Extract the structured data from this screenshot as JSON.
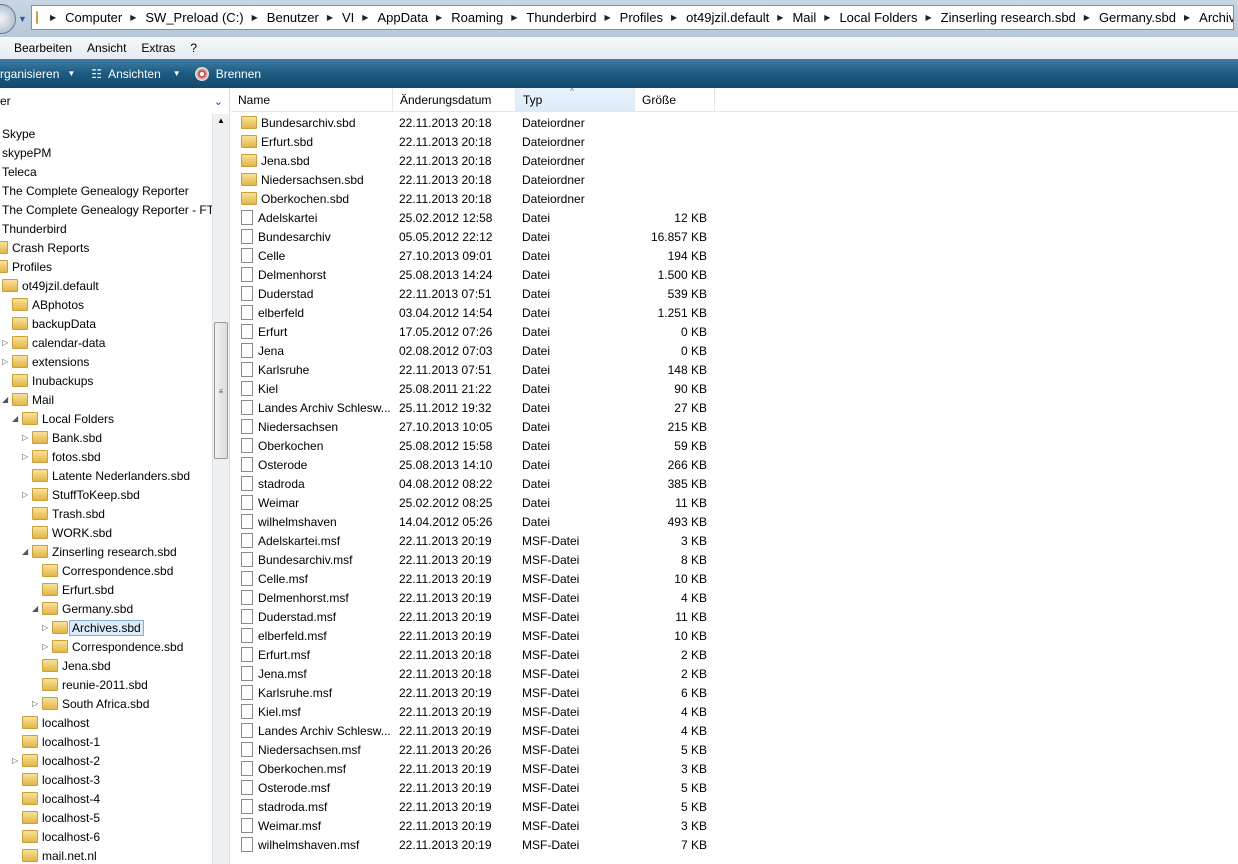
{
  "address": {
    "crumbs": [
      "Computer",
      "SW_Preload (C:)",
      "Benutzer",
      "VI",
      "AppData",
      "Roaming",
      "Thunderbird",
      "Profiles",
      "ot49jzil.default",
      "Mail",
      "Local Folders",
      "Zinserling research.sbd",
      "Germany.sbd",
      "Archives.sbd"
    ]
  },
  "menu": [
    "Bearbeiten",
    "Ansicht",
    "Extras",
    "?"
  ],
  "toolbar": {
    "organize": "rganisieren",
    "views": "Ansichten",
    "burn": "Brennen"
  },
  "tree": {
    "header": "er",
    "items": [
      {
        "label": "Skype",
        "x": 0,
        "a": ""
      },
      {
        "label": "skypePM",
        "x": 0,
        "a": ""
      },
      {
        "label": "Teleca",
        "x": 0,
        "a": ""
      },
      {
        "label": "The Complete Genealogy Reporter",
        "x": 0,
        "a": ""
      },
      {
        "label": "The Complete Genealogy Reporter - FTE",
        "x": 0,
        "a": ""
      },
      {
        "label": "Thunderbird",
        "x": 0,
        "a": ""
      },
      {
        "label": "Crash Reports",
        "x": 1,
        "a": ""
      },
      {
        "label": "Profiles",
        "x": 1,
        "a": ""
      },
      {
        "label": "ot49jzil.default",
        "x": 2,
        "a": "open"
      },
      {
        "label": "ABphotos",
        "x": 3,
        "a": ""
      },
      {
        "label": "backupData",
        "x": 3,
        "a": ""
      },
      {
        "label": "calendar-data",
        "x": 3,
        "a": "closed"
      },
      {
        "label": "extensions",
        "x": 3,
        "a": "closed"
      },
      {
        "label": "Inubackups",
        "x": 3,
        "a": ""
      },
      {
        "label": "Mail",
        "x": 3,
        "a": "open"
      },
      {
        "label": "Local Folders",
        "x": 4,
        "a": "open"
      },
      {
        "label": "Bank.sbd",
        "x": 5,
        "a": "closed"
      },
      {
        "label": "fotos.sbd",
        "x": 5,
        "a": "closed"
      },
      {
        "label": "Latente Nederlanders.sbd",
        "x": 5,
        "a": ""
      },
      {
        "label": "StuffToKeep.sbd",
        "x": 5,
        "a": "closed"
      },
      {
        "label": "Trash.sbd",
        "x": 5,
        "a": ""
      },
      {
        "label": "WORK.sbd",
        "x": 5,
        "a": ""
      },
      {
        "label": "Zinserling research.sbd",
        "x": 5,
        "a": "open"
      },
      {
        "label": "Correspondence.sbd",
        "x": 6,
        "a": ""
      },
      {
        "label": "Erfurt.sbd",
        "x": 6,
        "a": ""
      },
      {
        "label": "Germany.sbd",
        "x": 6,
        "a": "open"
      },
      {
        "label": "Archives.sbd",
        "x": 7,
        "a": "closed",
        "selected": true
      },
      {
        "label": "Correspondence.sbd",
        "x": 7,
        "a": "closed"
      },
      {
        "label": "Jena.sbd",
        "x": 6,
        "a": ""
      },
      {
        "label": "reunie-2011.sbd",
        "x": 6,
        "a": ""
      },
      {
        "label": "South Africa.sbd",
        "x": 6,
        "a": "closed"
      },
      {
        "label": "localhost",
        "x": 4,
        "a": ""
      },
      {
        "label": "localhost-1",
        "x": 4,
        "a": ""
      },
      {
        "label": "localhost-2",
        "x": 4,
        "a": "closed"
      },
      {
        "label": "localhost-3",
        "x": 4,
        "a": ""
      },
      {
        "label": "localhost-4",
        "x": 4,
        "a": ""
      },
      {
        "label": "localhost-5",
        "x": 4,
        "a": ""
      },
      {
        "label": "localhost-6",
        "x": 4,
        "a": ""
      },
      {
        "label": "mail.net.nl",
        "x": 4,
        "a": ""
      }
    ]
  },
  "columns": [
    "Name",
    "Änderungsdatum",
    "Typ",
    "Größe"
  ],
  "files": [
    [
      "Bundesarchiv.sbd",
      "22.11.2013 20:18",
      "Dateiordner",
      ""
    ],
    [
      "Erfurt.sbd",
      "22.11.2013 20:18",
      "Dateiordner",
      ""
    ],
    [
      "Jena.sbd",
      "22.11.2013 20:18",
      "Dateiordner",
      ""
    ],
    [
      "Niedersachsen.sbd",
      "22.11.2013 20:18",
      "Dateiordner",
      ""
    ],
    [
      "Oberkochen.sbd",
      "22.11.2013 20:18",
      "Dateiordner",
      ""
    ],
    [
      "Adelskartei",
      "25.02.2012 12:58",
      "Datei",
      "12 KB"
    ],
    [
      "Bundesarchiv",
      "05.05.2012 22:12",
      "Datei",
      "16.857 KB"
    ],
    [
      "Celle",
      "27.10.2013 09:01",
      "Datei",
      "194 KB"
    ],
    [
      "Delmenhorst",
      "25.08.2013 14:24",
      "Datei",
      "1.500 KB"
    ],
    [
      "Duderstad",
      "22.11.2013 07:51",
      "Datei",
      "539 KB"
    ],
    [
      "elberfeld",
      "03.04.2012 14:54",
      "Datei",
      "1.251 KB"
    ],
    [
      "Erfurt",
      "17.05.2012 07:26",
      "Datei",
      "0 KB"
    ],
    [
      "Jena",
      "02.08.2012 07:03",
      "Datei",
      "0 KB"
    ],
    [
      "Karlsruhe",
      "22.11.2013 07:51",
      "Datei",
      "148 KB"
    ],
    [
      "Kiel",
      "25.08.2011 21:22",
      "Datei",
      "90 KB"
    ],
    [
      "Landes Archiv Schlesw...",
      "25.11.2012 19:32",
      "Datei",
      "27 KB"
    ],
    [
      "Niedersachsen",
      "27.10.2013 10:05",
      "Datei",
      "215 KB"
    ],
    [
      "Oberkochen",
      "25.08.2012 15:58",
      "Datei",
      "59 KB"
    ],
    [
      "Osterode",
      "25.08.2013 14:10",
      "Datei",
      "266 KB"
    ],
    [
      "stadroda",
      "04.08.2012 08:22",
      "Datei",
      "385 KB"
    ],
    [
      "Weimar",
      "25.02.2012 08:25",
      "Datei",
      "11 KB"
    ],
    [
      "wilhelmshaven",
      "14.04.2012 05:26",
      "Datei",
      "493 KB"
    ],
    [
      "Adelskartei.msf",
      "22.11.2013 20:19",
      "MSF-Datei",
      "3 KB"
    ],
    [
      "Bundesarchiv.msf",
      "22.11.2013 20:19",
      "MSF-Datei",
      "8 KB"
    ],
    [
      "Celle.msf",
      "22.11.2013 20:19",
      "MSF-Datei",
      "10 KB"
    ],
    [
      "Delmenhorst.msf",
      "22.11.2013 20:19",
      "MSF-Datei",
      "4 KB"
    ],
    [
      "Duderstad.msf",
      "22.11.2013 20:19",
      "MSF-Datei",
      "11 KB"
    ],
    [
      "elberfeld.msf",
      "22.11.2013 20:19",
      "MSF-Datei",
      "10 KB"
    ],
    [
      "Erfurt.msf",
      "22.11.2013 20:18",
      "MSF-Datei",
      "2 KB"
    ],
    [
      "Jena.msf",
      "22.11.2013 20:18",
      "MSF-Datei",
      "2 KB"
    ],
    [
      "Karlsruhe.msf",
      "22.11.2013 20:19",
      "MSF-Datei",
      "6 KB"
    ],
    [
      "Kiel.msf",
      "22.11.2013 20:19",
      "MSF-Datei",
      "4 KB"
    ],
    [
      "Landes Archiv Schlesw...",
      "22.11.2013 20:19",
      "MSF-Datei",
      "4 KB"
    ],
    [
      "Niedersachsen.msf",
      "22.11.2013 20:26",
      "MSF-Datei",
      "5 KB"
    ],
    [
      "Oberkochen.msf",
      "22.11.2013 20:19",
      "MSF-Datei",
      "3 KB"
    ],
    [
      "Osterode.msf",
      "22.11.2013 20:19",
      "MSF-Datei",
      "5 KB"
    ],
    [
      "stadroda.msf",
      "22.11.2013 20:19",
      "MSF-Datei",
      "5 KB"
    ],
    [
      "Weimar.msf",
      "22.11.2013 20:19",
      "MSF-Datei",
      "3 KB"
    ],
    [
      "wilhelmshaven.msf",
      "22.11.2013 20:19",
      "MSF-Datei",
      "7 KB"
    ]
  ]
}
